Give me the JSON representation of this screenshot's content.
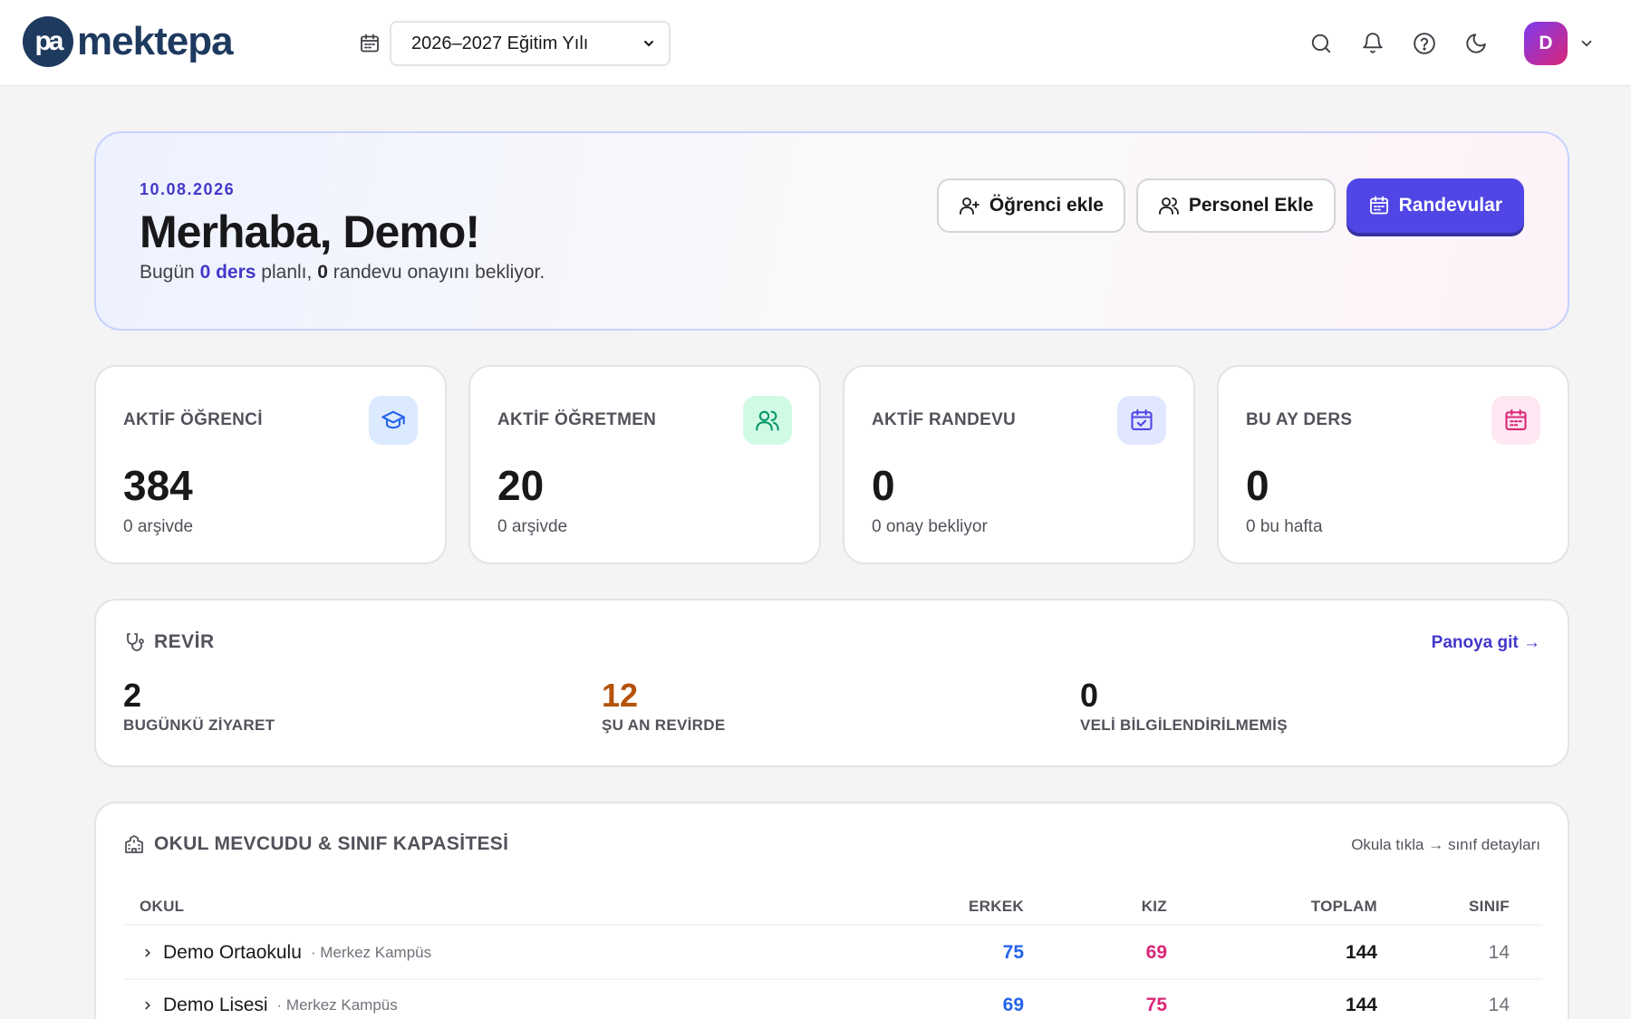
{
  "brand": {
    "logo_mark": "pa",
    "name": "mektepa"
  },
  "year_selector": {
    "value": "2026–2027 Eğitim Yılı"
  },
  "header_icons": [
    "search-icon",
    "bell-icon",
    "help-icon",
    "moon-icon"
  ],
  "user": {
    "initial": "D"
  },
  "welcome": {
    "date": "10.08.2026",
    "greeting": "Merhaba, Demo!",
    "summary_prefix": "Bugün",
    "summary_lessons": "0 ders",
    "summary_middle": "planlı,",
    "summary_appointments": "0",
    "summary_suffix": "randevu onayını bekliyor."
  },
  "actions": {
    "add_student": "Öğrenci ekle",
    "add_staff": "Personel Ekle",
    "appointments": "Randevular"
  },
  "stats": [
    {
      "label": "AKTİF ÖĞRENCİ",
      "value": "384",
      "sub": "0 arşivde",
      "icon": "graduation-cap-icon",
      "color": "#2563eb",
      "bg": "#dbeafe"
    },
    {
      "label": "AKTİF ÖĞRETMEN",
      "value": "20",
      "sub": "0 arşivde",
      "icon": "users-icon",
      "color": "#059669",
      "bg": "#d1fae5"
    },
    {
      "label": "AKTİF RANDEVU",
      "value": "0",
      "sub": "0 onay bekliyor",
      "icon": "calendar-check-icon",
      "color": "#4f46e5",
      "bg": "#e0e7ff"
    },
    {
      "label": "BU AY DERS",
      "value": "0",
      "sub": "0 bu hafta",
      "icon": "calendar-icon",
      "color": "#db2777",
      "bg": "#fce7f3"
    }
  ],
  "revir": {
    "title": "REVİR",
    "link": "Panoya git →",
    "metrics": [
      {
        "value": "2",
        "label": "BUGÜNKÜ ZİYARET",
        "color": "#18181b"
      },
      {
        "value": "12",
        "label": "ŞU AN REVİRDE",
        "color": "#b45309"
      },
      {
        "value": "0",
        "label": "VELİ BİLGİLENDİRİLMEMİŞ",
        "color": "#18181b"
      }
    ]
  },
  "school": {
    "title": "OKUL MEVCUDU & SINIF KAPASİTESİ",
    "hint": "Okula tıkla → sınıf detayları",
    "columns": {
      "okul": "OKUL",
      "erkek": "ERKEK",
      "kiz": "KIZ",
      "toplam": "TOPLAM",
      "sinif": "SINIF"
    },
    "rows": [
      {
        "name": "Demo Ortaokulu",
        "campus": "· Merkez Kampüs",
        "erkek": "75",
        "kiz": "69",
        "toplam": "144",
        "sinif": "14"
      },
      {
        "name": "Demo Lisesi",
        "campus": "· Merkez Kampüs",
        "erkek": "69",
        "kiz": "75",
        "toplam": "144",
        "sinif": "14"
      }
    ]
  }
}
